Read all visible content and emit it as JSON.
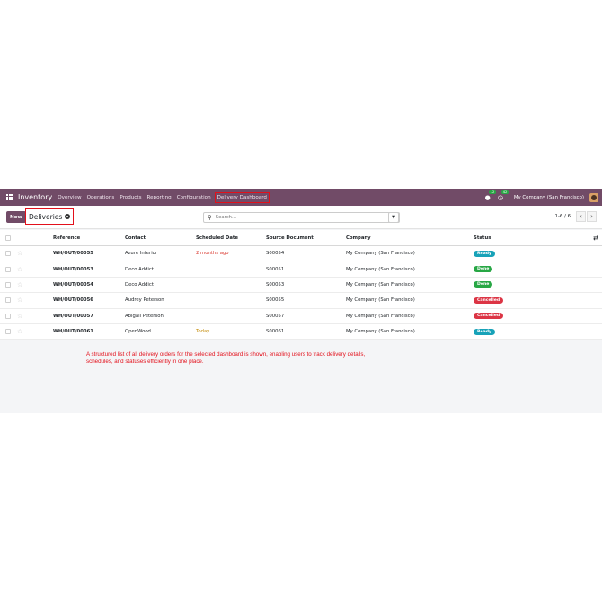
{
  "navbar": {
    "app_name": "Inventory",
    "menu": [
      "Overview",
      "Operations",
      "Products",
      "Reporting",
      "Configuration",
      "Delivery Dashboard"
    ],
    "messages_count": "12",
    "activities_count": "42",
    "company": "My Company (San Francisco)"
  },
  "control": {
    "new_label": "New",
    "breadcrumb": "Deliveries",
    "search_placeholder": "Search...",
    "pager_value": "1-6 / 6"
  },
  "columns": [
    "Reference",
    "Contact",
    "Scheduled Date",
    "Source Document",
    "Company",
    "Status"
  ],
  "rows": [
    {
      "reference": "WH/OUT/00055",
      "contact": "Azure Interior",
      "scheduled": "2 months ago",
      "source": "S00054",
      "company": "My Company (San Francisco)",
      "status": "Ready"
    },
    {
      "reference": "WH/OUT/00053",
      "contact": "Deco Addict",
      "scheduled": "",
      "source": "S00051",
      "company": "My Company (San Francisco)",
      "status": "Done"
    },
    {
      "reference": "WH/OUT/00054",
      "contact": "Deco Addict",
      "scheduled": "",
      "source": "S00053",
      "company": "My Company (San Francisco)",
      "status": "Done"
    },
    {
      "reference": "WH/OUT/00056",
      "contact": "Audrey Peterson",
      "scheduled": "",
      "source": "S00055",
      "company": "My Company (San Francisco)",
      "status": "Cancelled"
    },
    {
      "reference": "WH/OUT/00057",
      "contact": "Abigail Peterson",
      "scheduled": "",
      "source": "S00057",
      "company": "My Company (San Francisco)",
      "status": "Cancelled"
    },
    {
      "reference": "WH/OUT/00061",
      "contact": "OpenWood",
      "scheduled": "Today",
      "source": "S00061",
      "company": "My Company (San Francisco)",
      "status": "Ready"
    }
  ],
  "status_colors": {
    "Ready": "#17a2b8",
    "Done": "#28a745",
    "Cancelled": "#dc3545"
  },
  "date_colors": {
    "late": "#d9342b",
    "today": "#c48c0a"
  },
  "caption": "A structured list of all delivery orders for the selected dashboard is shown, enabling users to track delivery details, schedules, and statuses efficiently in one place.",
  "icons": {
    "apps": "apps-grid-icon",
    "search": "search-icon",
    "settings": "optional-columns-icon"
  }
}
